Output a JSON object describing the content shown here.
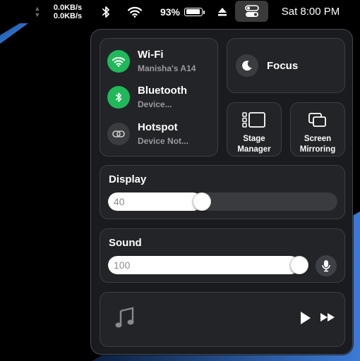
{
  "menubar": {
    "net_up": "0.0KB/s",
    "net_down": "0.0KB/s",
    "battery_percent": "93%",
    "battery_level": 0.93,
    "clock": "Sat 8:00 PM",
    "icons": [
      "network-arrows-icon",
      "bluetooth-icon",
      "wifi-icon",
      "battery-icon",
      "eject-icon",
      "control-center-icon"
    ]
  },
  "control_center": {
    "wifi": {
      "title": "Wi-Fi",
      "subtitle": "Manisha's A14",
      "on": true,
      "icon": "wifi-icon"
    },
    "bluetooth": {
      "title": "Bluetooth",
      "subtitle": "Device...",
      "on": true,
      "icon": "bluetooth-icon"
    },
    "hotspot": {
      "title": "Hotspot",
      "subtitle": "Device Not...",
      "on": false,
      "icon": "link-icon"
    },
    "focus": {
      "label": "Focus",
      "icon": "moon-icon"
    },
    "stage_manager": {
      "label_line1": "Stage",
      "label_line2": "Manager",
      "icon": "stage-manager-icon"
    },
    "screen_mirroring": {
      "label_line1": "Screen",
      "label_line2": "Mirroring",
      "icon": "screen-mirroring-icon"
    },
    "display": {
      "title": "Display",
      "value": "40",
      "level": 0.4
    },
    "sound": {
      "title": "Sound",
      "value": "100",
      "level": 1.0,
      "icon": "microphone-icon"
    },
    "media": {
      "icons": [
        "music-note-icon",
        "play-icon",
        "fast-forward-icon"
      ]
    }
  },
  "colors": {
    "toggle_on": "#1fb95a",
    "panel_bg": "#1a1b1e",
    "card_bg": "#232427"
  }
}
